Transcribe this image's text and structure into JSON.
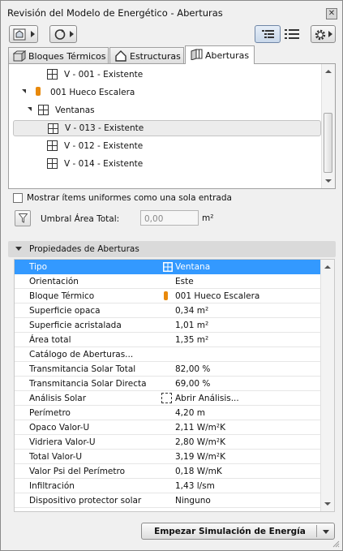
{
  "window": {
    "title": "Revisión del Modelo de Energético - Aberturas"
  },
  "tabs": [
    {
      "label": "Bloques Térmicos",
      "icon": "thermal-block-icon"
    },
    {
      "label": "Estructuras",
      "icon": "house-icon"
    },
    {
      "label": "Aberturas",
      "icon": "opening-icon",
      "active": true
    }
  ],
  "tree": {
    "rows": [
      {
        "label": "V - 001 - Existente",
        "icon": "window-icon"
      },
      {
        "label": "001 Hueco Escalera",
        "icon": "thermal-block-orange-icon",
        "expanded": true
      },
      {
        "label": "Ventanas",
        "icon": "window-icon",
        "expanded": true
      },
      {
        "label": "V - 013 - Existente",
        "icon": "window-icon",
        "selected": true
      },
      {
        "label": "V - 012 - Existente",
        "icon": "window-icon"
      },
      {
        "label": "V - 014 - Existente",
        "icon": "window-icon"
      }
    ]
  },
  "options": {
    "uniform_items_label": "Mostrar ítems uniformes como una sola entrada",
    "uniform_items_checked": false,
    "threshold_label": "Umbral Área Total:",
    "threshold_value": "0,00",
    "threshold_unit": "m²"
  },
  "properties": {
    "header": "Propiedades de Aberturas",
    "rows": [
      {
        "key": "Tipo",
        "value": "Ventana",
        "icon": "window-icon",
        "selected": true
      },
      {
        "key": "Orientación",
        "value": "Este"
      },
      {
        "key": "Bloque Térmico",
        "value": "001 Hueco Escalera",
        "icon": "thermal-block-orange-icon"
      },
      {
        "key": "Superficie opaca",
        "value": "0,34 m²"
      },
      {
        "key": "Superficie acristalada",
        "value": "1,01 m²"
      },
      {
        "key": "Área total",
        "value": "1,35 m²"
      },
      {
        "key": "Catálogo de Aberturas...",
        "value": ""
      },
      {
        "key": "Transmitancia Solar Total",
        "value": "82,00 %"
      },
      {
        "key": "Transmitancia Solar Directa",
        "value": "69,00 %"
      },
      {
        "key": "Análisis Solar",
        "value": "Abrir Análisis...",
        "icon": "dashed-box-icon"
      },
      {
        "key": "Perímetro",
        "value": "4,20 m"
      },
      {
        "key": "Opaco Valor-U",
        "value": "2,11 W/m²K"
      },
      {
        "key": "Vidriera Valor-U",
        "value": "2,80 W/m²K"
      },
      {
        "key": "Total Valor-U",
        "value": "3,19 W/m²K"
      },
      {
        "key": "Valor Psi del Perímetro",
        "value": "0,18 W/mK"
      },
      {
        "key": "Infiltración",
        "value": "1,43 l/sm"
      },
      {
        "key": "Dispositivo protector solar",
        "value": "Ninguno"
      }
    ]
  },
  "footer": {
    "simulate_label": "Empezar Simulación de Energía"
  },
  "colors": {
    "selection": "#3399ff",
    "thermal_block": "#e8890c"
  }
}
